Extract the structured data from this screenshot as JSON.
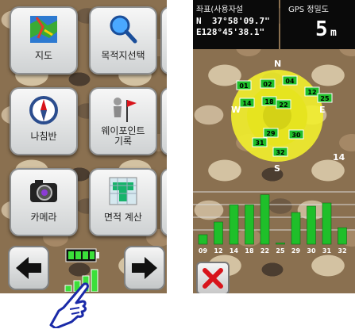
{
  "menu": {
    "tiles": [
      {
        "label": "지도",
        "icon": "map-icon"
      },
      {
        "label": "목적지선택",
        "icon": "search-icon"
      },
      {
        "label": "나침반",
        "icon": "compass-icon"
      },
      {
        "label": "웨이포인트 기록",
        "icon": "waypoint-flag-icon"
      },
      {
        "label": "카메라",
        "icon": "camera-icon"
      },
      {
        "label": "면적 계산",
        "icon": "area-calculation-icon"
      }
    ],
    "prev_icon": "arrow-left-icon",
    "next_icon": "arrow-right-icon",
    "battery_icon": "battery-icon",
    "signal_icon": "signal-strength-icon",
    "pointer_icon": "pointing-hand-icon"
  },
  "satellite": {
    "coord_title": "좌표(사용자설",
    "lat": "N  37°58'09.7\"",
    "lon": "E128°45'38.1\"",
    "accuracy_title": "GPS 정밀도",
    "accuracy_value": "5",
    "accuracy_unit": "m",
    "compass": {
      "n": "N",
      "s": "S",
      "e": "E",
      "w": "W"
    },
    "range_label": "14",
    "sky_sats": [
      "01",
      "02",
      "04",
      "12",
      "14",
      "18",
      "22",
      "25",
      "29",
      "30",
      "31",
      "32"
    ],
    "bar_labels": [
      "09",
      "12",
      "14",
      "18",
      "22",
      "25",
      "29",
      "30",
      "31",
      "32"
    ],
    "bar_values": [
      0.15,
      0.35,
      0.62,
      0.62,
      0.78,
      0.02,
      0.5,
      0.6,
      0.65,
      0.26
    ],
    "close_icon": "close-icon",
    "colors": {
      "bar": "#1fbf2a",
      "sky": "#f2ef2c",
      "header": "#0a0a0a",
      "close": "#d8141b"
    }
  }
}
